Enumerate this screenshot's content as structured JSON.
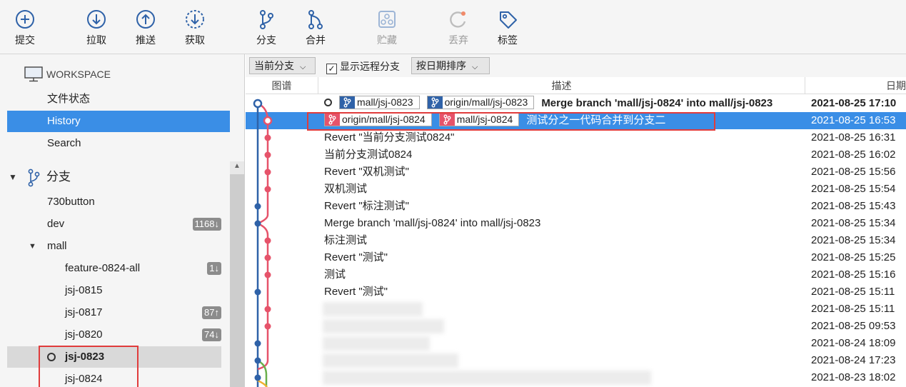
{
  "toolbar": {
    "commit": "提交",
    "pull": "拉取",
    "push": "推送",
    "fetch": "获取",
    "branch": "分支",
    "merge": "合并",
    "stash": "贮藏",
    "discard": "丢弃",
    "tag": "标签"
  },
  "sidebar": {
    "workspace": "WORKSPACE",
    "workspace_items": [
      "文件状态",
      "History",
      "Search"
    ],
    "branches_title": "分支",
    "branches": [
      {
        "name": "730button",
        "badge": ""
      },
      {
        "name": "dev",
        "badge": "1168↓"
      },
      {
        "name": "mall",
        "badge": ""
      },
      {
        "name": "feature-0824-all",
        "badge": "1↓"
      },
      {
        "name": "jsj-0815",
        "badge": ""
      },
      {
        "name": "jsj-0817",
        "badge": "87↑"
      },
      {
        "name": "jsj-0820",
        "badge": "74↓"
      },
      {
        "name": "jsj-0823",
        "badge": ""
      },
      {
        "name": "jsj-0824",
        "badge": ""
      }
    ]
  },
  "filters": {
    "current_branch": "当前分支",
    "show_remote": "显示远程分支",
    "sort_by_date": "按日期排序"
  },
  "columns": {
    "graph": "图谱",
    "description": "描述",
    "date": "日期"
  },
  "commits": [
    {
      "tags": [
        "mall/jsj-0823",
        "origin/mall/jsj-0823"
      ],
      "message": "Merge branch 'mall/jsj-0824' into mall/jsj-0823",
      "date": "2021-08-25 17:10"
    },
    {
      "tags": [
        "origin/mall/jsj-0824",
        "mall/jsj-0824"
      ],
      "message": "测试分之一代码合并到分支二",
      "date": "2021-08-25 16:53"
    },
    {
      "tags": [],
      "message": "Revert \"当前分支测试0824\"",
      "date": "2021-08-25 16:31"
    },
    {
      "tags": [],
      "message": "当前分支测试0824",
      "date": "2021-08-25 16:02"
    },
    {
      "tags": [],
      "message": "Revert \"双机测试\"",
      "date": "2021-08-25 15:56"
    },
    {
      "tags": [],
      "message": "双机测试",
      "date": "2021-08-25 15:54"
    },
    {
      "tags": [],
      "message": "Revert \"标注测试\"",
      "date": "2021-08-25 15:43"
    },
    {
      "tags": [],
      "message": "Merge branch 'mall/jsj-0824' into mall/jsj-0823",
      "date": "2021-08-25 15:34"
    },
    {
      "tags": [],
      "message": "标注测试",
      "date": "2021-08-25 15:34"
    },
    {
      "tags": [],
      "message": "Revert \"测试\"",
      "date": "2021-08-25 15:25"
    },
    {
      "tags": [],
      "message": "测试",
      "date": "2021-08-25 15:16"
    },
    {
      "tags": [],
      "message": "Revert \"测试\"",
      "date": "2021-08-25 15:11"
    },
    {
      "tags": [],
      "message": "",
      "date": "2021-08-25 15:11"
    },
    {
      "tags": [],
      "message": "",
      "date": "2021-08-25 09:53"
    },
    {
      "tags": [],
      "message": "",
      "date": "2021-08-24 18:09"
    },
    {
      "tags": [],
      "message": "",
      "date": "2021-08-24 17:23"
    },
    {
      "tags": [],
      "message": "",
      "date": "2021-08-23 18:02"
    }
  ]
}
